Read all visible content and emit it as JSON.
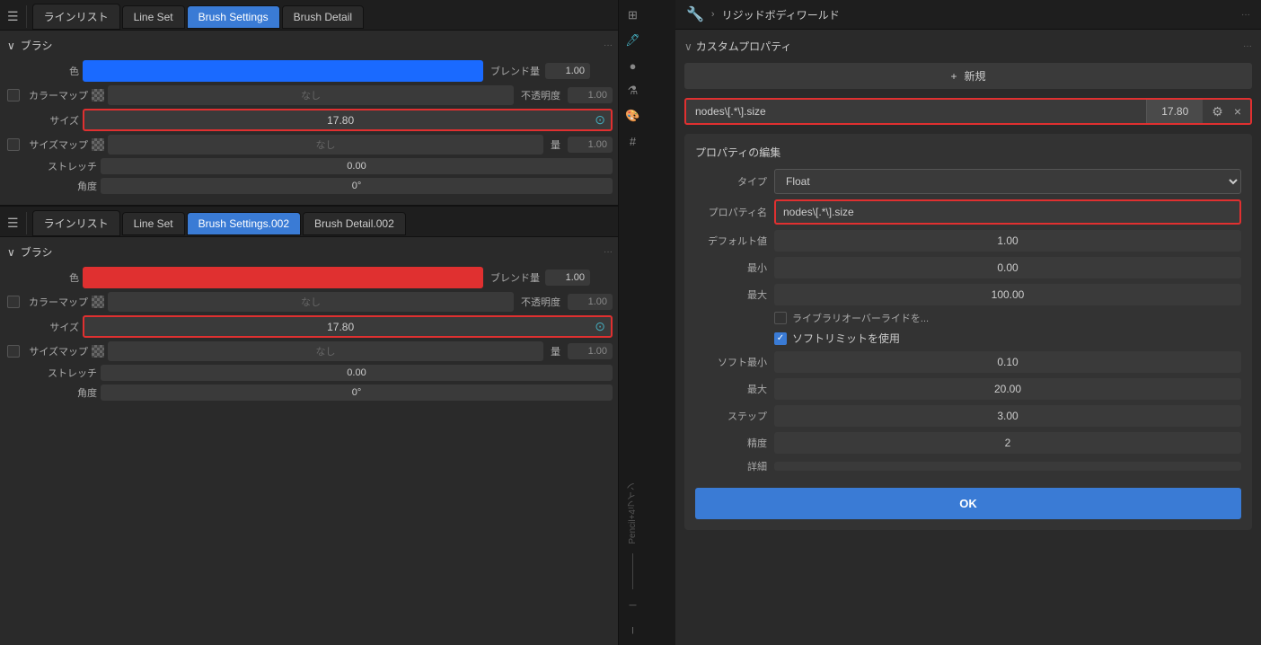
{
  "left": {
    "tab_menu_icon": "☰",
    "tabs_top": [
      {
        "label": "ラインリスト",
        "active": false
      },
      {
        "label": "Line Set",
        "active": false
      },
      {
        "label": "Brush Settings",
        "active": true
      },
      {
        "label": "Brush Detail",
        "active": false
      }
    ],
    "tabs_bottom": [
      {
        "label": "ラインリスト",
        "active": false
      },
      {
        "label": "Line Set",
        "active": false
      },
      {
        "label": "Brush Settings.002",
        "active": true
      },
      {
        "label": "Brush Detail.002",
        "active": false
      }
    ],
    "panel1": {
      "section_label": "ブラシ",
      "section_dots": "···",
      "color_label": "色",
      "color_swatch": "#1a6aff",
      "blend_label": "ブレンド量",
      "blend_value": "1.00",
      "color_map_label": "カラーマップ",
      "color_map_value": "なし",
      "opacity_label": "不透明度",
      "opacity_value": "1.00",
      "size_label": "サイズ",
      "size_value": "17.80",
      "size_map_label": "サイズマップ",
      "size_map_value": "なし",
      "size_map_amount": "量",
      "size_map_amount_val": "1.00",
      "stretch_label": "ストレッチ",
      "stretch_value": "0.00",
      "angle_label": "角度",
      "angle_value": "0°"
    },
    "panel2": {
      "section_label": "ブラシ",
      "section_dots": "···",
      "color_label": "色",
      "color_swatch": "#e03030",
      "blend_label": "ブレンド量",
      "blend_value": "1.00",
      "color_map_label": "カラーマップ",
      "color_map_value": "なし",
      "opacity_label": "不透明度",
      "opacity_value": "1.00",
      "size_label": "サイズ",
      "size_value": "17.80",
      "size_map_label": "サイズマップ",
      "size_map_value": "なし",
      "size_map_amount": "量",
      "size_map_amount_val": "1.00",
      "stretch_label": "ストレッチ",
      "stretch_value": "0.00",
      "angle_label": "角度",
      "angle_value": "0°"
    },
    "pencil_label": "Pencil+4ライン",
    "icon_bar": [
      "🔧",
      "🖍",
      "⬡",
      "🎨",
      "⊞"
    ]
  },
  "right": {
    "wrench_icon": "🔧",
    "rigid_body_label": "リジッドボディワールド",
    "dots": "···",
    "custom_prop_label": "カスタムプロパティ",
    "custom_dots": "···",
    "new_button_label": "新規",
    "new_icon": "+",
    "prop_key": "nodes\\[.*\\].size",
    "prop_value": "17.80",
    "prop_gear": "⚙",
    "prop_close": "×",
    "edit_section_title": "プロパティの編集",
    "type_label": "タイプ",
    "type_value": "Float",
    "prop_name_label": "プロパティ名",
    "prop_name_value": "nodes\\[.*\\].size",
    "default_label": "デフォルト値",
    "default_value": "1.00",
    "min_label": "最小",
    "min_value": "0.00",
    "max_label": "最大",
    "max_value": "100.00",
    "lib_override_label": "ライブラリオーバーライドを...",
    "soft_limit_label": "ソフトリミットを使用",
    "soft_min_label": "ソフト最小",
    "soft_min_value": "0.10",
    "soft_max_label": "最大",
    "soft_max_value": "20.00",
    "step_label": "ステップ",
    "step_value": "3.00",
    "precision_label": "精度",
    "precision_value": "2",
    "detail_label": "詳細",
    "detail_value": "",
    "ok_button_label": "OK"
  }
}
